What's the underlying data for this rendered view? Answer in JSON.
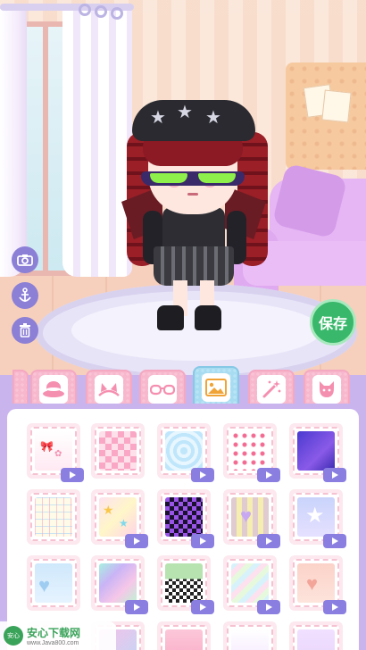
{
  "scene": {
    "save_label": "保存"
  },
  "tools": [
    {
      "icon": "camera-icon"
    },
    {
      "icon": "anchor-icon"
    },
    {
      "icon": "trash-icon"
    }
  ],
  "tabs": [
    {
      "icon": "hat-icon",
      "active": false
    },
    {
      "icon": "cat-ears-icon",
      "active": false
    },
    {
      "icon": "glasses-icon",
      "active": false
    },
    {
      "icon": "background-image-icon",
      "active": true
    },
    {
      "icon": "magic-wand-icon",
      "active": false
    },
    {
      "icon": "cat-pet-icon",
      "active": false
    }
  ],
  "items": [
    {
      "kind": "bows",
      "video": true
    },
    {
      "kind": "checker-pink",
      "video": false
    },
    {
      "kind": "heart-rings",
      "video": true
    },
    {
      "kind": "hearts-pattern",
      "video": true
    },
    {
      "kind": "galaxy",
      "video": true
    },
    {
      "kind": "heart-grid",
      "video": false
    },
    {
      "kind": "stars-pastel",
      "video": true
    },
    {
      "kind": "checker-purple",
      "video": true
    },
    {
      "kind": "plaid-heart",
      "video": true
    },
    {
      "kind": "star-blue",
      "video": true
    },
    {
      "kind": "sky-hearts",
      "video": false
    },
    {
      "kind": "holo",
      "video": true
    },
    {
      "kind": "drip",
      "video": true
    },
    {
      "kind": "pastel-stripes",
      "video": true
    },
    {
      "kind": "peach-hearts",
      "video": true
    },
    {
      "kind": "row4-a",
      "video": false
    },
    {
      "kind": "row4-b",
      "video": false
    },
    {
      "kind": "row4-c",
      "video": false
    },
    {
      "kind": "row4-d",
      "video": false
    },
    {
      "kind": "row4-e",
      "video": false
    }
  ],
  "watermark": {
    "title": "安心下载网",
    "url": "www.Java800.com",
    "logo_text": "安心"
  },
  "colors": {
    "accent_purple": "#8a7fe0",
    "save_green": "#39b86b",
    "tab_pink": "#f7b7cc",
    "tab_active_blue": "#a8dcf1"
  }
}
